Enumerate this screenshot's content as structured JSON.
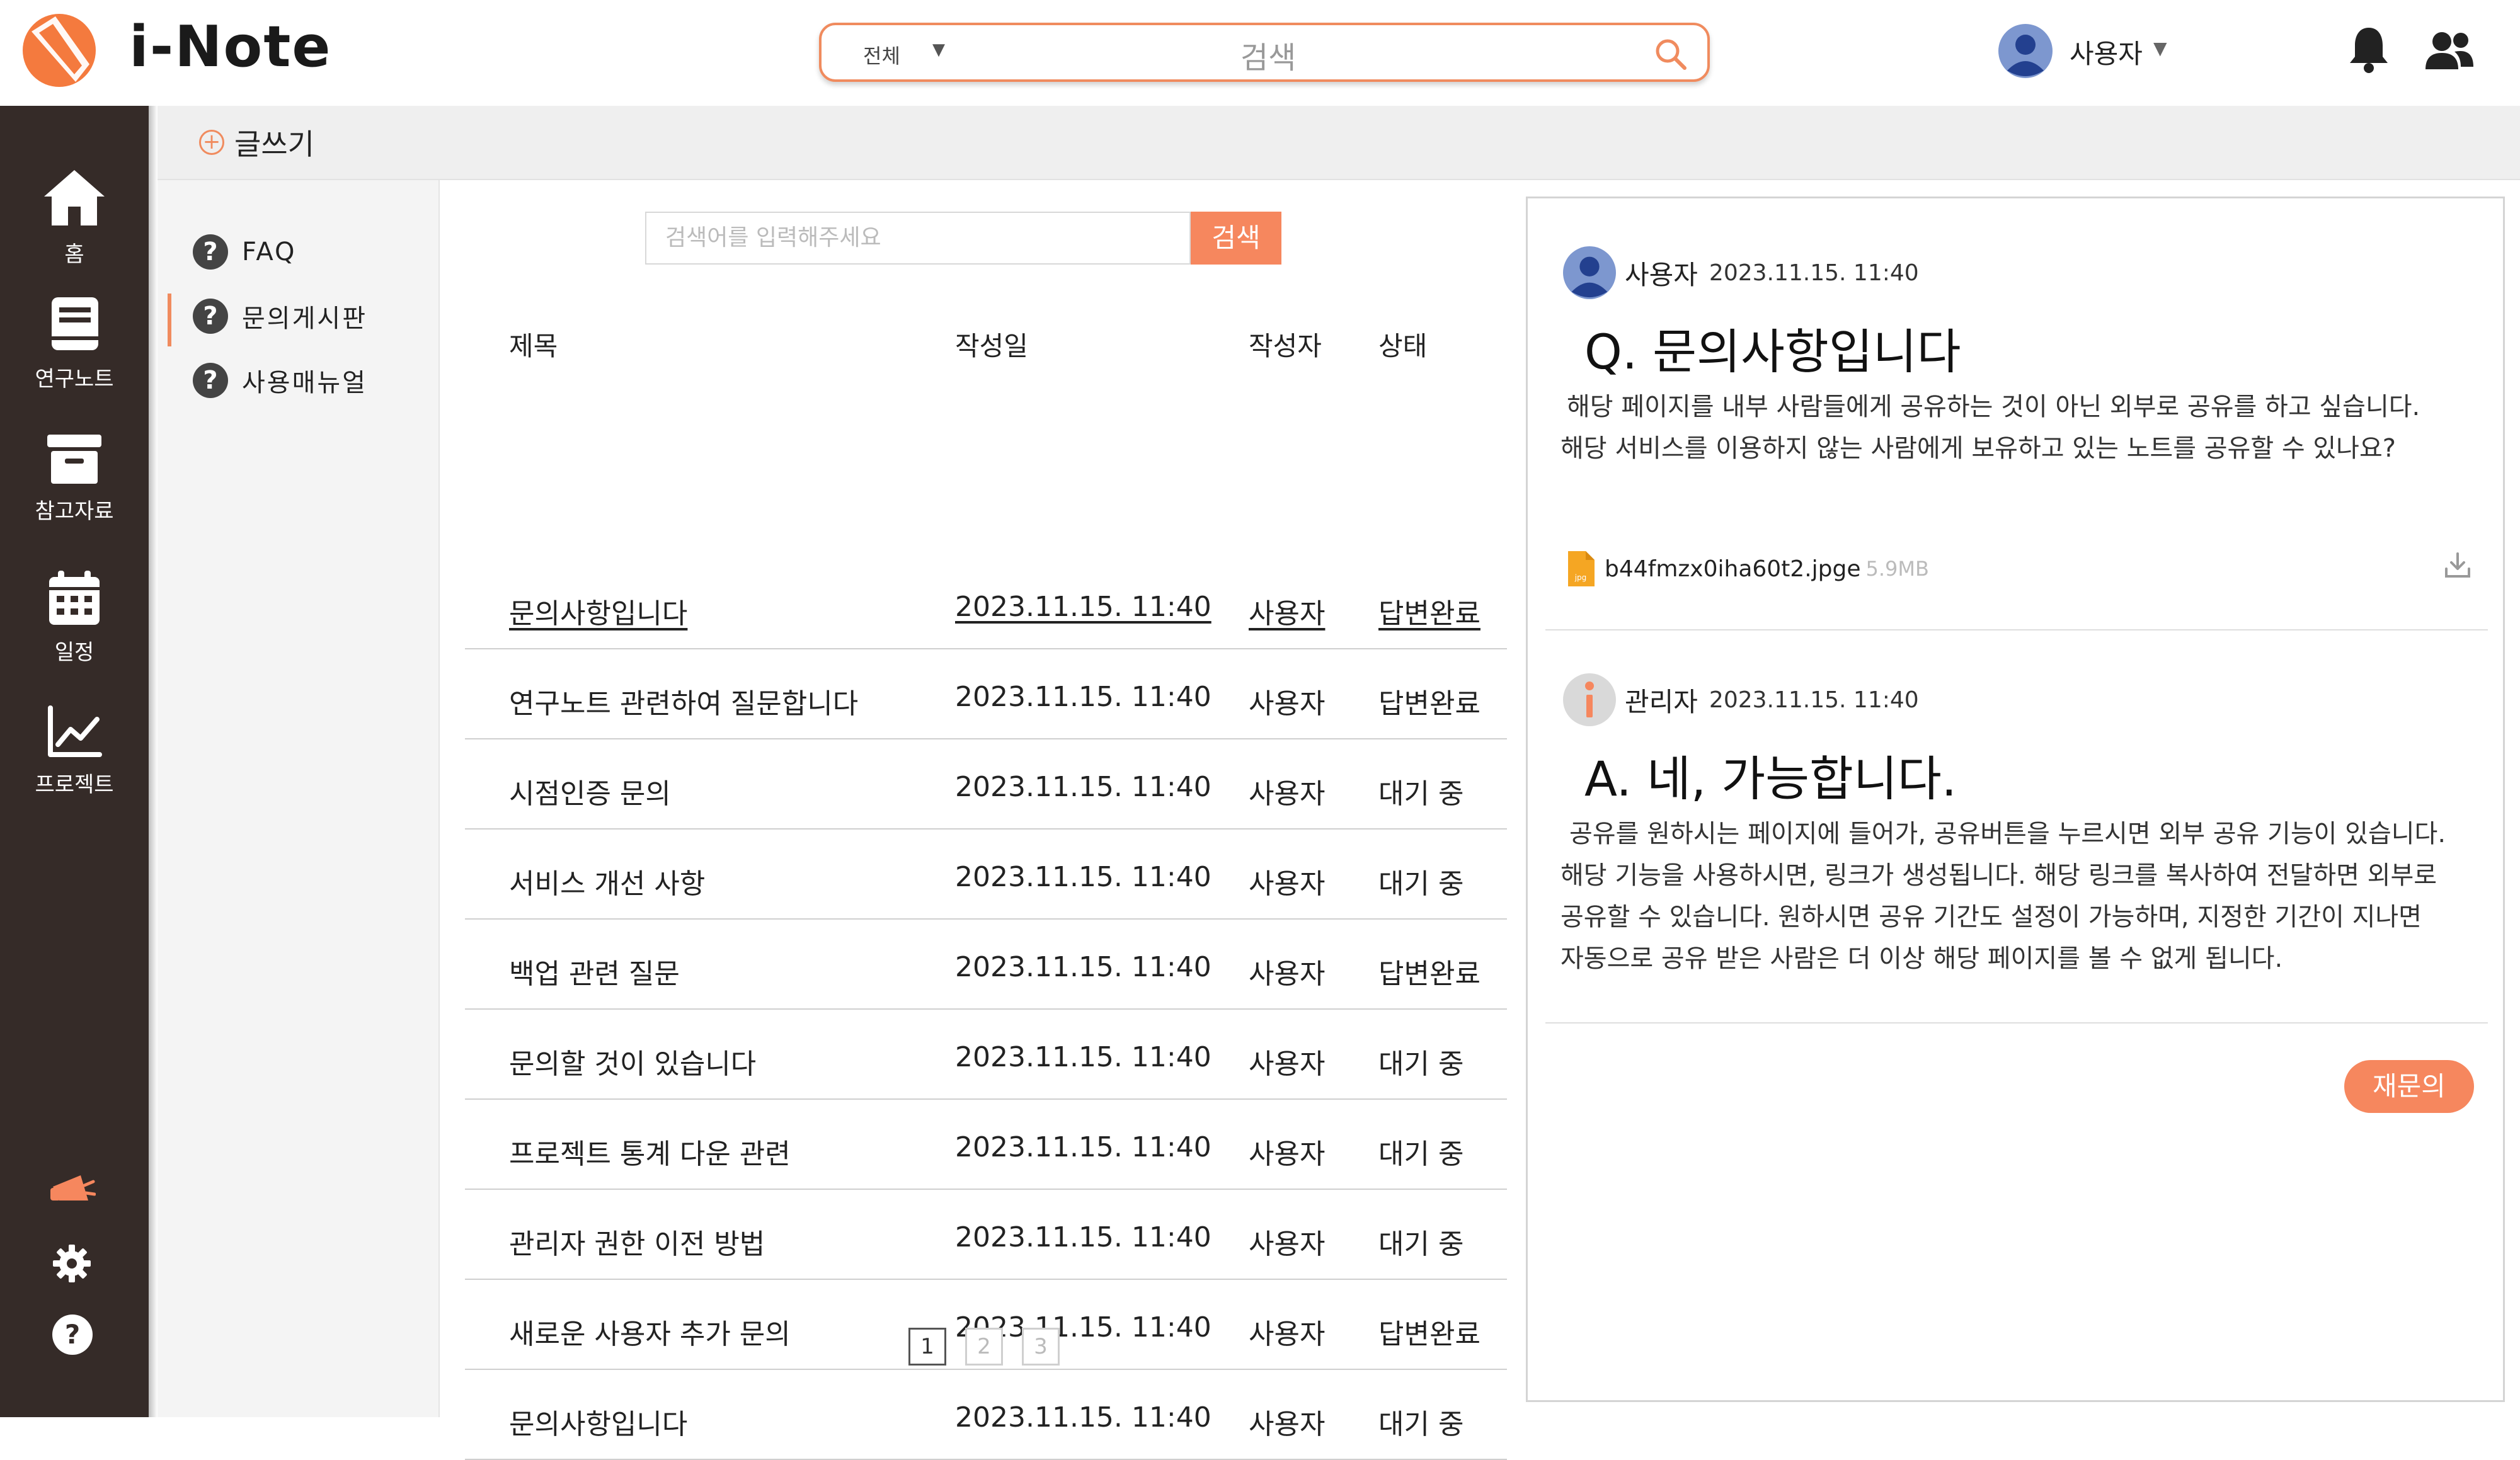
{
  "app": {
    "logo_text": "i-Note",
    "accent_color": "#f6875e",
    "sidebar_color": "#352b28"
  },
  "header": {
    "search": {
      "scope": "전체",
      "placeholder": "검색"
    },
    "user": {
      "name": "사용자",
      "icon": "user-avatar-icon"
    },
    "icons": [
      "bell-icon",
      "people-icon"
    ]
  },
  "sidebar": {
    "items": [
      {
        "label": "홈",
        "icon": "home-icon"
      },
      {
        "label": "연구노트",
        "icon": "notebook-icon"
      },
      {
        "label": "참고자료",
        "icon": "archive-icon"
      },
      {
        "label": "일정",
        "icon": "calendar-icon"
      },
      {
        "label": "프로젝트",
        "icon": "chart-icon"
      }
    ],
    "bottom_icons": [
      "megaphone-icon",
      "gear-icon",
      "help-icon"
    ]
  },
  "topbar": {
    "write_label": "글쓰기"
  },
  "submenu": {
    "items": [
      {
        "label": "FAQ"
      },
      {
        "label": "문의게시판",
        "active": true
      },
      {
        "label": "사용매뉴얼"
      }
    ]
  },
  "list": {
    "search_placeholder": "검색어를 입력해주세요",
    "search_button": "검색",
    "columns": [
      "제목",
      "작성일",
      "작성자",
      "상태"
    ],
    "rows": [
      [
        "문의사항입니다",
        "2023.11.15. 11:40",
        "사용자",
        "답변완료"
      ],
      [
        "연구노트 관련하여 질문합니다",
        "2023.11.15. 11:40",
        "사용자",
        "답변완료"
      ],
      [
        "시점인증 문의",
        "2023.11.15. 11:40",
        "사용자",
        "대기 중"
      ],
      [
        "서비스 개선 사항",
        "2023.11.15. 11:40",
        "사용자",
        "대기 중"
      ],
      [
        "백업 관련 질문",
        "2023.11.15. 11:40",
        "사용자",
        "답변완료"
      ],
      [
        "문의할 것이 있습니다",
        "2023.11.15. 11:40",
        "사용자",
        "대기 중"
      ],
      [
        "프로젝트 통계 다운 관련",
        "2023.11.15. 11:40",
        "사용자",
        "대기 중"
      ],
      [
        "관리자 권한 이전 방법",
        "2023.11.15. 11:40",
        "사용자",
        "대기 중"
      ],
      [
        "새로운 사용자 추가 문의",
        "2023.11.15. 11:40",
        "사용자",
        "답변완료"
      ],
      [
        "문의사항입니다",
        "2023.11.15. 11:40",
        "사용자",
        "대기 중"
      ]
    ],
    "pages": [
      "1",
      "2",
      "3"
    ],
    "current_page": "1"
  },
  "detail": {
    "question": {
      "author": "사용자",
      "date": "2023.11.15. 11:40",
      "title": "Q. 문의사항입니다",
      "body_lines": [
        "해당 페이지를 내부 사람들에게 공유하는 것이 아닌 외부로 공유를 하고 싶습니다.",
        "해당 서비스를 이용하지 않는 사람에게 보유하고 있는 노트를 공유할 수 있나요?"
      ],
      "attachment": {
        "name": "b44fmzx0iha60t2.jpge",
        "size": "5.9MB",
        "type": "jpg"
      }
    },
    "answer": {
      "author": "관리자",
      "date": "2023.11.15. 11:40",
      "title": "A. 네, 가능합니다.",
      "body_lines": [
        "공유를 원하시는 페이지에 들어가, 공유버튼을 누르시면 외부 공유 기능이 있습니다.",
        "해당 기능을 사용하시면, 링크가 생성됩니다. 해당 링크를 복사하여 전달하면 외부로",
        "공유할 수 있습니다. 원하시면 공유 기간도 설정이 가능하며, 지정한 기간이 지나면",
        "자동으로 공유 받은 사람은 더 이상 해당 페이지를 볼 수 없게 됩니다."
      ]
    },
    "reask_label": "재문의"
  }
}
